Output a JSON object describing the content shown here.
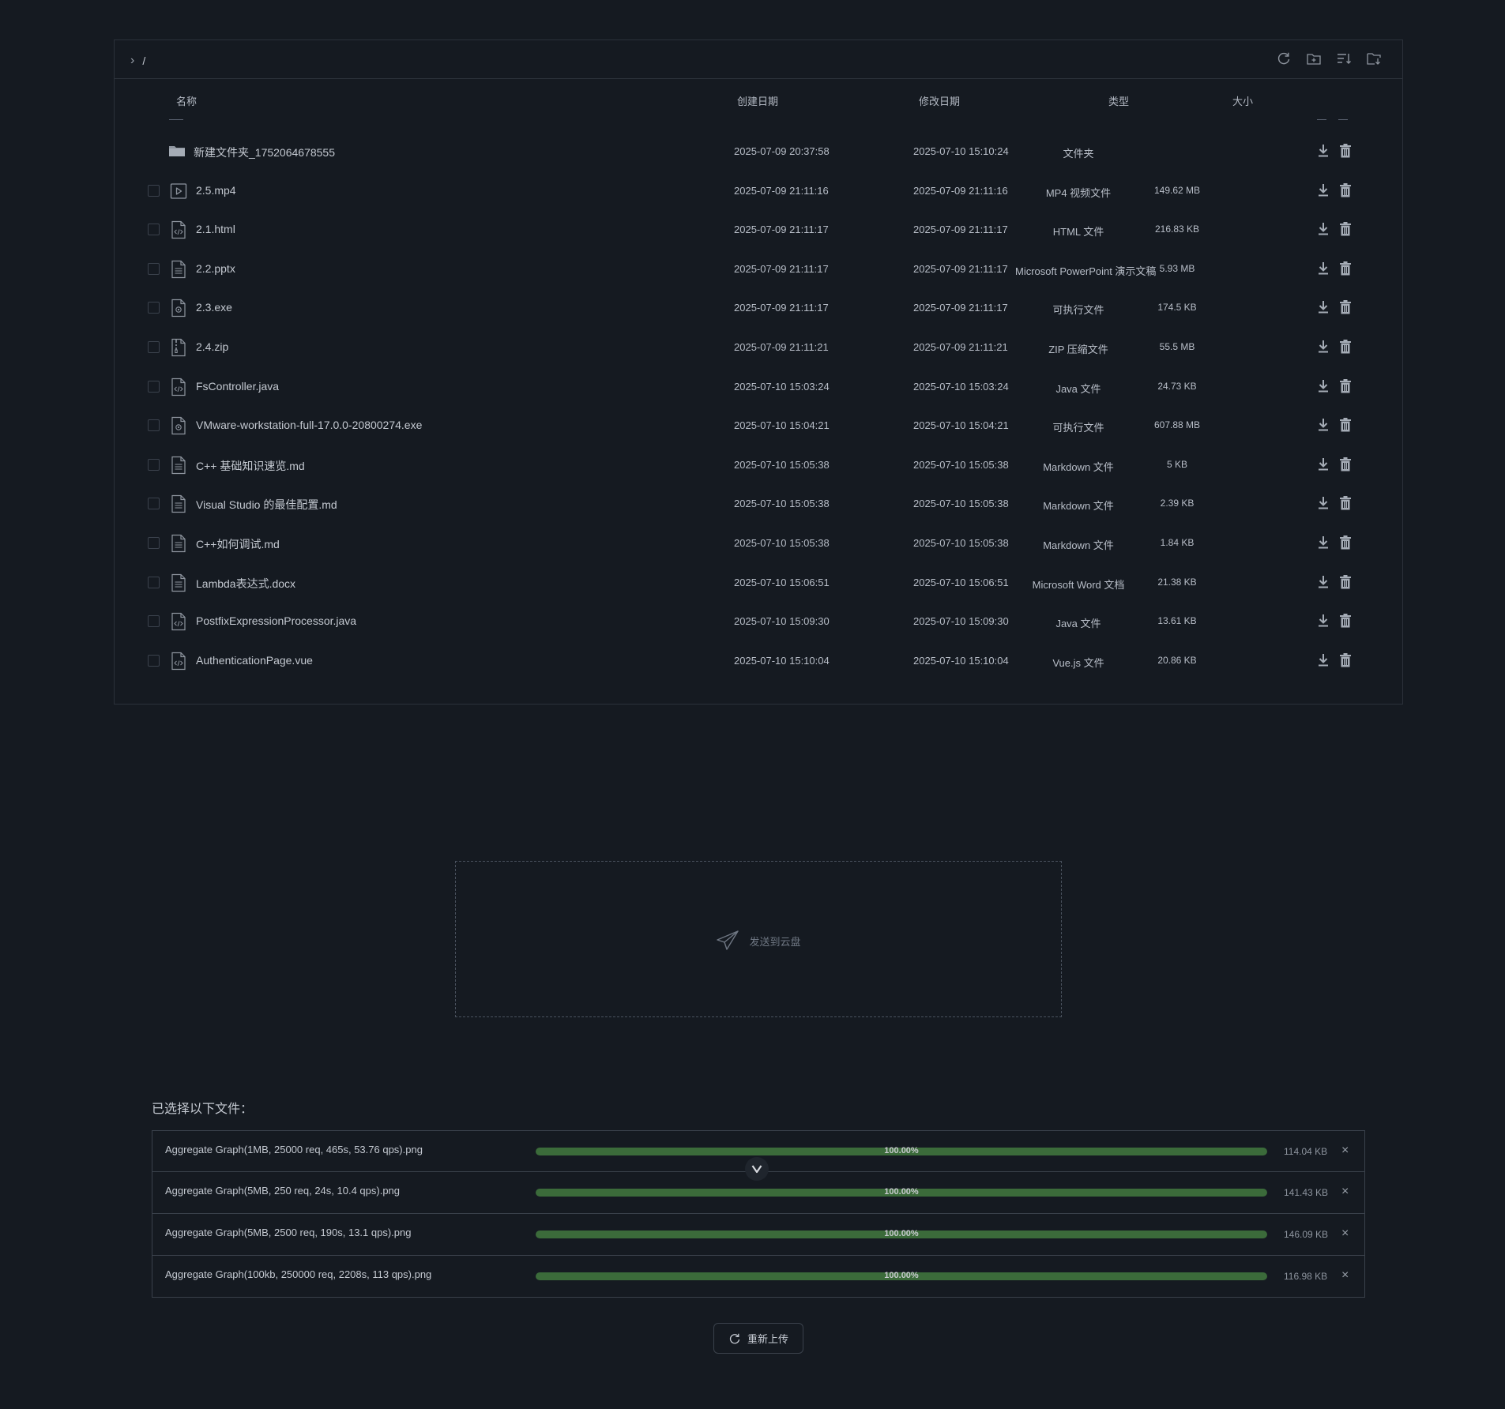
{
  "breadcrumb": {
    "path": "/"
  },
  "toolbar": {
    "icons": [
      "refresh-icon",
      "new-folder-icon",
      "sort-icon",
      "download-folder-icon"
    ]
  },
  "columns": {
    "name": "名称",
    "created": "创建日期",
    "modified": "修改日期",
    "type": "类型",
    "size": "大小"
  },
  "files": [
    {
      "name": "新建文件夹_1752064678555",
      "icon": "folder-icon",
      "created": "2025-07-09 20:37:58",
      "modified": "2025-07-10 15:10:24",
      "type": "文件夹",
      "size": "",
      "checkbox": false
    },
    {
      "name": "2.5.mp4",
      "icon": "video-file-icon",
      "created": "2025-07-09 21:11:16",
      "modified": "2025-07-09 21:11:16",
      "type": "MP4 视频文件",
      "size": "149.62 MB",
      "checkbox": true
    },
    {
      "name": "2.1.html",
      "icon": "code-file-icon",
      "created": "2025-07-09 21:11:17",
      "modified": "2025-07-09 21:11:17",
      "type": "HTML 文件",
      "size": "216.83 KB",
      "checkbox": true
    },
    {
      "name": "2.2.pptx",
      "icon": "document-file-icon",
      "created": "2025-07-09 21:11:17",
      "modified": "2025-07-09 21:11:17",
      "type": "Microsoft PowerPoint 演示文稿",
      "size": "5.93 MB",
      "checkbox": true
    },
    {
      "name": "2.3.exe",
      "icon": "executable-file-icon",
      "created": "2025-07-09 21:11:17",
      "modified": "2025-07-09 21:11:17",
      "type": "可执行文件",
      "size": "174.5 KB",
      "checkbox": true
    },
    {
      "name": "2.4.zip",
      "icon": "archive-file-icon",
      "created": "2025-07-09 21:11:21",
      "modified": "2025-07-09 21:11:21",
      "type": "ZIP 压缩文件",
      "size": "55.5 MB",
      "checkbox": true
    },
    {
      "name": "FsController.java",
      "icon": "code-file-icon",
      "created": "2025-07-10 15:03:24",
      "modified": "2025-07-10 15:03:24",
      "type": "Java 文件",
      "size": "24.73 KB",
      "checkbox": true
    },
    {
      "name": "VMware-workstation-full-17.0.0-20800274.exe",
      "icon": "executable-file-icon",
      "created": "2025-07-10 15:04:21",
      "modified": "2025-07-10 15:04:21",
      "type": "可执行文件",
      "size": "607.88 MB",
      "checkbox": true
    },
    {
      "name": "C++ 基础知识速览.md",
      "icon": "document-file-icon",
      "created": "2025-07-10 15:05:38",
      "modified": "2025-07-10 15:05:38",
      "type": "Markdown 文件",
      "size": "5 KB",
      "checkbox": true
    },
    {
      "name": "Visual Studio 的最佳配置.md",
      "icon": "document-file-icon",
      "created": "2025-07-10 15:05:38",
      "modified": "2025-07-10 15:05:38",
      "type": "Markdown 文件",
      "size": "2.39 KB",
      "checkbox": true
    },
    {
      "name": "C++如何调试.md",
      "icon": "document-file-icon",
      "created": "2025-07-10 15:05:38",
      "modified": "2025-07-10 15:05:38",
      "type": "Markdown 文件",
      "size": "1.84 KB",
      "checkbox": true
    },
    {
      "name": "Lambda表达式.docx",
      "icon": "document-file-icon",
      "created": "2025-07-10 15:06:51",
      "modified": "2025-07-10 15:06:51",
      "type": "Microsoft Word 文档",
      "size": "21.38 KB",
      "checkbox": true
    },
    {
      "name": "PostfixExpressionProcessor.java",
      "icon": "code-file-icon",
      "created": "2025-07-10 15:09:30",
      "modified": "2025-07-10 15:09:30",
      "type": "Java 文件",
      "size": "13.61 KB",
      "checkbox": true
    },
    {
      "name": "AuthenticationPage.vue",
      "icon": "code-file-icon",
      "created": "2025-07-10 15:10:04",
      "modified": "2025-07-10 15:10:04",
      "type": "Vue.js 文件",
      "size": "20.86 KB",
      "checkbox": true
    }
  ],
  "dropzone": {
    "text": "发送到云盘",
    "icon": "paper-plane-icon"
  },
  "upload": {
    "title": "已选择以下文件：",
    "items": [
      {
        "name": "Aggregate Graph(1MB, 25000 req, 465s, 53.76 qps).png",
        "progress": 100,
        "progress_label": "100.00%",
        "size": "114.04 KB"
      },
      {
        "name": "Aggregate Graph(5MB, 250 req, 24s, 10.4 qps).png",
        "progress": 100,
        "progress_label": "100.00%",
        "size": "141.43 KB"
      },
      {
        "name": "Aggregate Graph(5MB, 2500 req, 190s, 13.1 qps).png",
        "progress": 100,
        "progress_label": "100.00%",
        "size": "146.09 KB"
      },
      {
        "name": "Aggregate Graph(100kb, 250000 req, 2208s, 113 qps).png",
        "progress": 100,
        "progress_label": "100.00%",
        "size": "116.98 KB"
      }
    ],
    "close_glyph": "×",
    "reupload_label": "重新上传"
  },
  "colors": {
    "background": "#151a21",
    "border": "#2b313a",
    "progress_fill": "#3b6b3a",
    "text": "#b8bec8"
  }
}
